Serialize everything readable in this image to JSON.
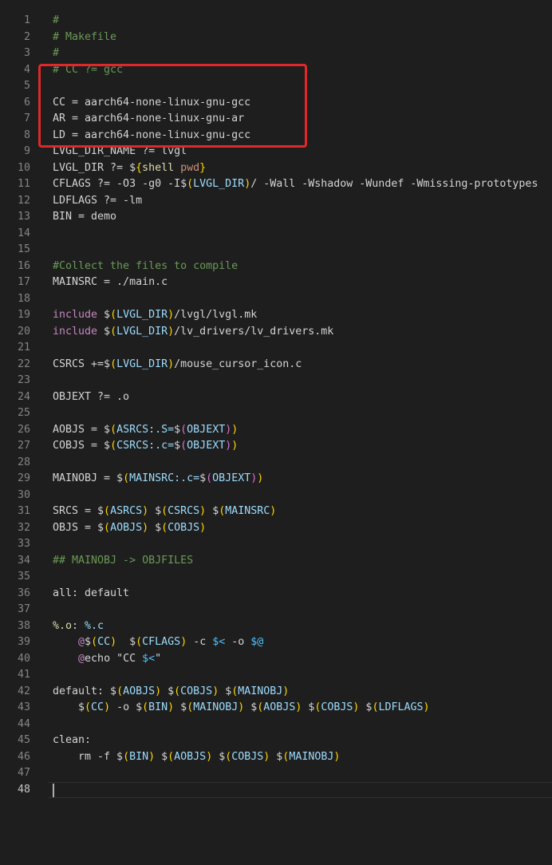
{
  "editor": {
    "lines": [
      {
        "n": "1",
        "tokens": [
          {
            "t": "#",
            "c": "c"
          }
        ]
      },
      {
        "n": "2",
        "tokens": [
          {
            "t": "# Makefile",
            "c": "c"
          }
        ]
      },
      {
        "n": "3",
        "tokens": [
          {
            "t": "#",
            "c": "c"
          }
        ]
      },
      {
        "n": "4",
        "tokens": [
          {
            "t": "# CC ?= gcc",
            "c": "c"
          }
        ]
      },
      {
        "n": "5",
        "tokens": []
      },
      {
        "n": "6",
        "tokens": [
          {
            "t": "CC = aarch64-none-linux-gnu-gcc",
            "c": "t"
          }
        ]
      },
      {
        "n": "7",
        "tokens": [
          {
            "t": "AR = aarch64-none-linux-gnu-ar",
            "c": "t"
          }
        ]
      },
      {
        "n": "8",
        "tokens": [
          {
            "t": "LD = aarch64-none-linux-gnu-gcc",
            "c": "t"
          }
        ]
      },
      {
        "n": "9",
        "tokens": [
          {
            "t": "LVGL_DIR_NAME ?= lvgl",
            "c": "t"
          }
        ]
      },
      {
        "n": "10",
        "tokens": [
          {
            "t": "LVGL_DIR ?= ",
            "c": "t"
          },
          {
            "t": "$",
            "c": "t"
          },
          {
            "t": "{",
            "c": "b"
          },
          {
            "t": "shell",
            "c": "f"
          },
          {
            "t": " pwd",
            "c": "s"
          },
          {
            "t": "}",
            "c": "b"
          }
        ]
      },
      {
        "n": "11",
        "tokens": [
          {
            "t": "CFLAGS ?= -O3 -g0 -I",
            "c": "t"
          },
          {
            "t": "$",
            "c": "t"
          },
          {
            "t": "(",
            "c": "b"
          },
          {
            "t": "LVGL_DIR",
            "c": "v"
          },
          {
            "t": ")",
            "c": "b"
          },
          {
            "t": "/ -Wall -Wshadow -Wundef -Wmissing-prototypes",
            "c": "t"
          }
        ]
      },
      {
        "n": "12",
        "tokens": [
          {
            "t": "LDFLAGS ?= -lm",
            "c": "t"
          }
        ]
      },
      {
        "n": "13",
        "tokens": [
          {
            "t": "BIN = demo",
            "c": "t"
          }
        ]
      },
      {
        "n": "14",
        "tokens": []
      },
      {
        "n": "15",
        "tokens": []
      },
      {
        "n": "16",
        "tokens": [
          {
            "t": "#Collect the files to compile",
            "c": "c"
          }
        ]
      },
      {
        "n": "17",
        "tokens": [
          {
            "t": "MAINSRC = ./main.c",
            "c": "t"
          }
        ]
      },
      {
        "n": "18",
        "tokens": []
      },
      {
        "n": "19",
        "tokens": [
          {
            "t": "include",
            "c": "k"
          },
          {
            "t": " $",
            "c": "t"
          },
          {
            "t": "(",
            "c": "b"
          },
          {
            "t": "LVGL_DIR",
            "c": "v"
          },
          {
            "t": ")",
            "c": "b"
          },
          {
            "t": "/lvgl/lvgl.mk",
            "c": "t"
          }
        ]
      },
      {
        "n": "20",
        "tokens": [
          {
            "t": "include",
            "c": "k"
          },
          {
            "t": " $",
            "c": "t"
          },
          {
            "t": "(",
            "c": "b"
          },
          {
            "t": "LVGL_DIR",
            "c": "v"
          },
          {
            "t": ")",
            "c": "b"
          },
          {
            "t": "/lv_drivers/lv_drivers.mk",
            "c": "t"
          }
        ]
      },
      {
        "n": "21",
        "tokens": []
      },
      {
        "n": "22",
        "tokens": [
          {
            "t": "CSRCS +=$",
            "c": "t"
          },
          {
            "t": "(",
            "c": "b"
          },
          {
            "t": "LVGL_DIR",
            "c": "v"
          },
          {
            "t": ")",
            "c": "b"
          },
          {
            "t": "/mouse_cursor_icon.c",
            "c": "t"
          }
        ]
      },
      {
        "n": "23",
        "tokens": []
      },
      {
        "n": "24",
        "tokens": [
          {
            "t": "OBJEXT ?= .o",
            "c": "t"
          }
        ]
      },
      {
        "n": "25",
        "tokens": []
      },
      {
        "n": "26",
        "tokens": [
          {
            "t": "AOBJS = $",
            "c": "t"
          },
          {
            "t": "(",
            "c": "b"
          },
          {
            "t": "ASRCS:.S=",
            "c": "v"
          },
          {
            "t": "$",
            "c": "t"
          },
          {
            "t": "(",
            "c": "bp"
          },
          {
            "t": "OBJEXT",
            "c": "v"
          },
          {
            "t": ")",
            "c": "bp"
          },
          {
            "t": ")",
            "c": "b"
          }
        ]
      },
      {
        "n": "27",
        "tokens": [
          {
            "t": "COBJS = $",
            "c": "t"
          },
          {
            "t": "(",
            "c": "b"
          },
          {
            "t": "CSRCS:.c=",
            "c": "v"
          },
          {
            "t": "$",
            "c": "t"
          },
          {
            "t": "(",
            "c": "bp"
          },
          {
            "t": "OBJEXT",
            "c": "v"
          },
          {
            "t": ")",
            "c": "bp"
          },
          {
            "t": ")",
            "c": "b"
          }
        ]
      },
      {
        "n": "28",
        "tokens": []
      },
      {
        "n": "29",
        "tokens": [
          {
            "t": "MAINOBJ = $",
            "c": "t"
          },
          {
            "t": "(",
            "c": "b"
          },
          {
            "t": "MAINSRC:.c=",
            "c": "v"
          },
          {
            "t": "$",
            "c": "t"
          },
          {
            "t": "(",
            "c": "bp"
          },
          {
            "t": "OBJEXT",
            "c": "v"
          },
          {
            "t": ")",
            "c": "bp"
          },
          {
            "t": ")",
            "c": "b"
          }
        ]
      },
      {
        "n": "30",
        "tokens": []
      },
      {
        "n": "31",
        "tokens": [
          {
            "t": "SRCS = $",
            "c": "t"
          },
          {
            "t": "(",
            "c": "b"
          },
          {
            "t": "ASRCS",
            "c": "v"
          },
          {
            "t": ")",
            "c": "b"
          },
          {
            "t": " $",
            "c": "t"
          },
          {
            "t": "(",
            "c": "b"
          },
          {
            "t": "CSRCS",
            "c": "v"
          },
          {
            "t": ")",
            "c": "b"
          },
          {
            "t": " $",
            "c": "t"
          },
          {
            "t": "(",
            "c": "b"
          },
          {
            "t": "MAINSRC",
            "c": "v"
          },
          {
            "t": ")",
            "c": "b"
          }
        ]
      },
      {
        "n": "32",
        "tokens": [
          {
            "t": "OBJS = $",
            "c": "t"
          },
          {
            "t": "(",
            "c": "b"
          },
          {
            "t": "AOBJS",
            "c": "v"
          },
          {
            "t": ")",
            "c": "b"
          },
          {
            "t": " $",
            "c": "t"
          },
          {
            "t": "(",
            "c": "b"
          },
          {
            "t": "COBJS",
            "c": "v"
          },
          {
            "t": ")",
            "c": "b"
          }
        ]
      },
      {
        "n": "33",
        "tokens": []
      },
      {
        "n": "34",
        "tokens": [
          {
            "t": "## MAINOBJ -> OBJFILES",
            "c": "c"
          }
        ]
      },
      {
        "n": "35",
        "tokens": []
      },
      {
        "n": "36",
        "tokens": [
          {
            "t": "all: default",
            "c": "t"
          }
        ]
      },
      {
        "n": "37",
        "tokens": []
      },
      {
        "n": "38",
        "tokens": [
          {
            "t": "%.o",
            "c": "f"
          },
          {
            "t": ": ",
            "c": "t"
          },
          {
            "t": "%.c",
            "c": "v"
          }
        ]
      },
      {
        "n": "39",
        "tokens": [
          {
            "t": "    ",
            "c": "t"
          },
          {
            "t": "@",
            "c": "k"
          },
          {
            "t": "$",
            "c": "t"
          },
          {
            "t": "(",
            "c": "b"
          },
          {
            "t": "CC",
            "c": "v"
          },
          {
            "t": ")",
            "c": "b"
          },
          {
            "t": "  $",
            "c": "t"
          },
          {
            "t": "(",
            "c": "b"
          },
          {
            "t": "CFLAGS",
            "c": "v"
          },
          {
            "t": ")",
            "c": "b"
          },
          {
            "t": " -c ",
            "c": "t"
          },
          {
            "t": "$<",
            "c": "u"
          },
          {
            "t": " -o ",
            "c": "t"
          },
          {
            "t": "$@",
            "c": "u"
          }
        ]
      },
      {
        "n": "40",
        "tokens": [
          {
            "t": "    ",
            "c": "t"
          },
          {
            "t": "@",
            "c": "k"
          },
          {
            "t": "echo \"CC ",
            "c": "t"
          },
          {
            "t": "$<",
            "c": "u"
          },
          {
            "t": "\"",
            "c": "t"
          }
        ]
      },
      {
        "n": "41",
        "tokens": []
      },
      {
        "n": "42",
        "tokens": [
          {
            "t": "default: $",
            "c": "t"
          },
          {
            "t": "(",
            "c": "b"
          },
          {
            "t": "AOBJS",
            "c": "v"
          },
          {
            "t": ")",
            "c": "b"
          },
          {
            "t": " $",
            "c": "t"
          },
          {
            "t": "(",
            "c": "b"
          },
          {
            "t": "COBJS",
            "c": "v"
          },
          {
            "t": ")",
            "c": "b"
          },
          {
            "t": " $",
            "c": "t"
          },
          {
            "t": "(",
            "c": "b"
          },
          {
            "t": "MAINOBJ",
            "c": "v"
          },
          {
            "t": ")",
            "c": "b"
          }
        ]
      },
      {
        "n": "43",
        "tokens": [
          {
            "t": "    $",
            "c": "t"
          },
          {
            "t": "(",
            "c": "b"
          },
          {
            "t": "CC",
            "c": "v"
          },
          {
            "t": ")",
            "c": "b"
          },
          {
            "t": " -o $",
            "c": "t"
          },
          {
            "t": "(",
            "c": "b"
          },
          {
            "t": "BIN",
            "c": "v"
          },
          {
            "t": ")",
            "c": "b"
          },
          {
            "t": " $",
            "c": "t"
          },
          {
            "t": "(",
            "c": "b"
          },
          {
            "t": "MAINOBJ",
            "c": "v"
          },
          {
            "t": ")",
            "c": "b"
          },
          {
            "t": " $",
            "c": "t"
          },
          {
            "t": "(",
            "c": "b"
          },
          {
            "t": "AOBJS",
            "c": "v"
          },
          {
            "t": ")",
            "c": "b"
          },
          {
            "t": " $",
            "c": "t"
          },
          {
            "t": "(",
            "c": "b"
          },
          {
            "t": "COBJS",
            "c": "v"
          },
          {
            "t": ")",
            "c": "b"
          },
          {
            "t": " $",
            "c": "t"
          },
          {
            "t": "(",
            "c": "b"
          },
          {
            "t": "LDFLAGS",
            "c": "v"
          },
          {
            "t": ")",
            "c": "b"
          }
        ]
      },
      {
        "n": "44",
        "tokens": []
      },
      {
        "n": "45",
        "tokens": [
          {
            "t": "clean:",
            "c": "t"
          }
        ]
      },
      {
        "n": "46",
        "tokens": [
          {
            "t": "    rm -f $",
            "c": "t"
          },
          {
            "t": "(",
            "c": "b"
          },
          {
            "t": "BIN",
            "c": "v"
          },
          {
            "t": ")",
            "c": "b"
          },
          {
            "t": " $",
            "c": "t"
          },
          {
            "t": "(",
            "c": "b"
          },
          {
            "t": "AOBJS",
            "c": "v"
          },
          {
            "t": ")",
            "c": "b"
          },
          {
            "t": " $",
            "c": "t"
          },
          {
            "t": "(",
            "c": "b"
          },
          {
            "t": "COBJS",
            "c": "v"
          },
          {
            "t": ")",
            "c": "b"
          },
          {
            "t": " $",
            "c": "t"
          },
          {
            "t": "(",
            "c": "b"
          },
          {
            "t": "MAINOBJ",
            "c": "v"
          },
          {
            "t": ")",
            "c": "b"
          }
        ]
      },
      {
        "n": "47",
        "tokens": []
      },
      {
        "n": "48",
        "tokens": [],
        "active": true
      }
    ]
  },
  "colors": {
    "background": "#1e1e1e",
    "highlight_box": "#e0282a",
    "comment": "#6a9955",
    "variable": "#9cdcfe",
    "keyword": "#c586c0",
    "bracket": "#ffd700",
    "function": "#dcdcaa",
    "string": "#ce9178"
  }
}
